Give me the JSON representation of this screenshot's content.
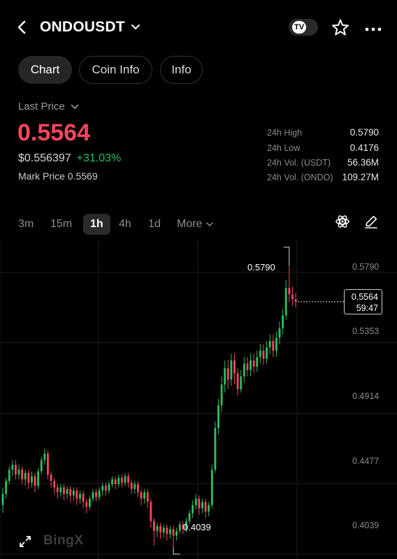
{
  "header": {
    "symbol": "ONDOUSDT",
    "tv_badge": "TV"
  },
  "tabs": [
    {
      "label": "Chart"
    },
    {
      "label": "Coin Info"
    },
    {
      "label": "Info"
    }
  ],
  "price": {
    "last_price_label": "Last Price",
    "last_price": "0.5564",
    "usd_price": "$0.556397",
    "change": "+31.03%",
    "mark_price": "Mark Price 0.5569",
    "colors": {
      "down": "#f6465d",
      "up": "#2ebd5f"
    }
  },
  "stats": [
    {
      "label": "24h High",
      "value": "0.5790"
    },
    {
      "label": "24h Low",
      "value": "0.4176"
    },
    {
      "label": "24h Vol. (USDT)",
      "value": "56.36M"
    },
    {
      "label": "24h Vol. (ONDO)",
      "value": "109.27M"
    }
  ],
  "timeframes": [
    "3m",
    "15m",
    "1h",
    "4h",
    "1d",
    "More"
  ],
  "active_timeframe": "1h",
  "chart": {
    "axis_labels": [
      "0.5790",
      "0.5353",
      "0.4914",
      "0.4477",
      "0.4039"
    ],
    "high_marker": "0.5790",
    "low_marker": "0.4039",
    "current_price": "0.5564",
    "countdown": "59:47",
    "watermark": "BingX"
  },
  "chart_data": {
    "type": "candlestick",
    "y_range": [
      0.3965,
      0.595
    ],
    "axis_ticks": [
      0.579,
      0.5353,
      0.4914,
      0.4477,
      0.4039
    ],
    "candles_ohlc": [
      [
        0.43,
        0.437,
        0.425,
        0.441
      ],
      [
        0.437,
        0.445,
        0.434,
        0.447
      ],
      [
        0.445,
        0.452,
        0.443,
        0.454
      ],
      [
        0.452,
        0.455,
        0.448,
        0.458
      ],
      [
        0.455,
        0.449,
        0.446,
        0.458
      ],
      [
        0.449,
        0.452,
        0.446,
        0.455
      ],
      [
        0.452,
        0.446,
        0.443,
        0.454
      ],
      [
        0.446,
        0.45,
        0.442,
        0.452
      ],
      [
        0.45,
        0.444,
        0.44,
        0.452
      ],
      [
        0.444,
        0.448,
        0.441,
        0.451
      ],
      [
        0.448,
        0.442,
        0.438,
        0.45
      ],
      [
        0.442,
        0.451,
        0.44,
        0.453
      ],
      [
        0.451,
        0.458,
        0.449,
        0.46
      ],
      [
        0.458,
        0.462,
        0.455,
        0.465
      ],
      [
        0.462,
        0.449,
        0.446,
        0.464
      ],
      [
        0.449,
        0.445,
        0.441,
        0.451
      ],
      [
        0.445,
        0.441,
        0.437,
        0.447
      ],
      [
        0.441,
        0.438,
        0.434,
        0.443
      ],
      [
        0.438,
        0.441,
        0.435,
        0.443
      ],
      [
        0.441,
        0.437,
        0.433,
        0.443
      ],
      [
        0.437,
        0.44,
        0.434,
        0.442
      ],
      [
        0.44,
        0.436,
        0.432,
        0.442
      ],
      [
        0.436,
        0.439,
        0.433,
        0.441
      ],
      [
        0.439,
        0.434,
        0.43,
        0.441
      ],
      [
        0.434,
        0.437,
        0.431,
        0.439
      ],
      [
        0.437,
        0.432,
        0.428,
        0.439
      ],
      [
        0.432,
        0.429,
        0.425,
        0.434
      ],
      [
        0.429,
        0.434,
        0.427,
        0.436
      ],
      [
        0.434,
        0.438,
        0.432,
        0.44
      ],
      [
        0.438,
        0.435,
        0.432,
        0.44
      ],
      [
        0.435,
        0.439,
        0.433,
        0.441
      ],
      [
        0.439,
        0.442,
        0.436,
        0.444
      ],
      [
        0.442,
        0.439,
        0.436,
        0.444
      ],
      [
        0.439,
        0.443,
        0.437,
        0.445
      ],
      [
        0.443,
        0.446,
        0.441,
        0.448
      ],
      [
        0.446,
        0.443,
        0.44,
        0.448
      ],
      [
        0.443,
        0.447,
        0.441,
        0.449
      ],
      [
        0.447,
        0.444,
        0.441,
        0.449
      ],
      [
        0.444,
        0.448,
        0.442,
        0.45
      ],
      [
        0.448,
        0.444,
        0.441,
        0.45
      ],
      [
        0.444,
        0.44,
        0.437,
        0.446
      ],
      [
        0.44,
        0.443,
        0.437,
        0.445
      ],
      [
        0.443,
        0.438,
        0.435,
        0.445
      ],
      [
        0.438,
        0.434,
        0.43,
        0.44
      ],
      [
        0.434,
        0.438,
        0.431,
        0.44
      ],
      [
        0.438,
        0.432,
        0.428,
        0.44
      ],
      [
        0.432,
        0.42,
        0.416,
        0.434
      ],
      [
        0.42,
        0.414,
        0.405,
        0.422
      ],
      [
        0.414,
        0.417,
        0.41,
        0.419
      ],
      [
        0.417,
        0.413,
        0.409,
        0.419
      ],
      [
        0.413,
        0.416,
        0.41,
        0.418
      ],
      [
        0.416,
        0.412,
        0.408,
        0.418
      ],
      [
        0.412,
        0.415,
        0.409,
        0.417
      ],
      [
        0.415,
        0.411,
        0.4039,
        0.417
      ],
      [
        0.411,
        0.414,
        0.408,
        0.416
      ],
      [
        0.414,
        0.418,
        0.412,
        0.42
      ],
      [
        0.418,
        0.415,
        0.412,
        0.42
      ],
      [
        0.415,
        0.42,
        0.413,
        0.422
      ],
      [
        0.42,
        0.425,
        0.418,
        0.427
      ],
      [
        0.425,
        0.43,
        0.422,
        0.433
      ],
      [
        0.43,
        0.434,
        0.427,
        0.437
      ],
      [
        0.434,
        0.428,
        0.424,
        0.436
      ],
      [
        0.428,
        0.432,
        0.425,
        0.434
      ],
      [
        0.432,
        0.426,
        0.422,
        0.434
      ],
      [
        0.426,
        0.43,
        0.423,
        0.432
      ],
      [
        0.43,
        0.452,
        0.428,
        0.455
      ],
      [
        0.452,
        0.478,
        0.45,
        0.482
      ],
      [
        0.478,
        0.492,
        0.474,
        0.496
      ],
      [
        0.492,
        0.505,
        0.488,
        0.51
      ],
      [
        0.505,
        0.515,
        0.5,
        0.52
      ],
      [
        0.515,
        0.508,
        0.502,
        0.52
      ],
      [
        0.508,
        0.52,
        0.504,
        0.524
      ],
      [
        0.52,
        0.512,
        0.505,
        0.524
      ],
      [
        0.512,
        0.502,
        0.498,
        0.515
      ],
      [
        0.502,
        0.51,
        0.5,
        0.514
      ],
      [
        0.51,
        0.518,
        0.506,
        0.522
      ],
      [
        0.518,
        0.514,
        0.51,
        0.522
      ],
      [
        0.514,
        0.52,
        0.51,
        0.524
      ],
      [
        0.52,
        0.516,
        0.512,
        0.524
      ],
      [
        0.516,
        0.522,
        0.513,
        0.526
      ],
      [
        0.522,
        0.526,
        0.518,
        0.53
      ],
      [
        0.526,
        0.521,
        0.517,
        0.53
      ],
      [
        0.521,
        0.528,
        0.518,
        0.532
      ],
      [
        0.528,
        0.532,
        0.524,
        0.536
      ],
      [
        0.532,
        0.526,
        0.522,
        0.536
      ],
      [
        0.526,
        0.534,
        0.522,
        0.538
      ],
      [
        0.534,
        0.54,
        0.53,
        0.544
      ],
      [
        0.54,
        0.548,
        0.536,
        0.552
      ],
      [
        0.548,
        0.565,
        0.545,
        0.57
      ],
      [
        0.565,
        0.561,
        0.556,
        0.579
      ],
      [
        0.561,
        0.558,
        0.554,
        0.566
      ],
      [
        0.558,
        0.5564,
        0.553,
        0.562
      ]
    ]
  }
}
